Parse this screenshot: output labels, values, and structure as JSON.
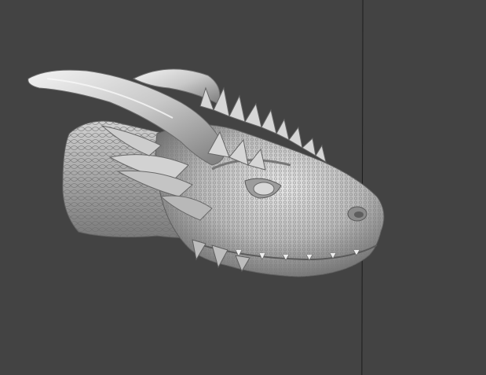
{
  "viewport": {
    "background_color": "#434343",
    "guide_line_color": "#1c1c1c",
    "model": {
      "name": "dragon-head-sculpt",
      "material_color": "#c9c9c9",
      "shadow_color": "#6b6b6b",
      "highlight_color": "#f2f2f2"
    }
  }
}
